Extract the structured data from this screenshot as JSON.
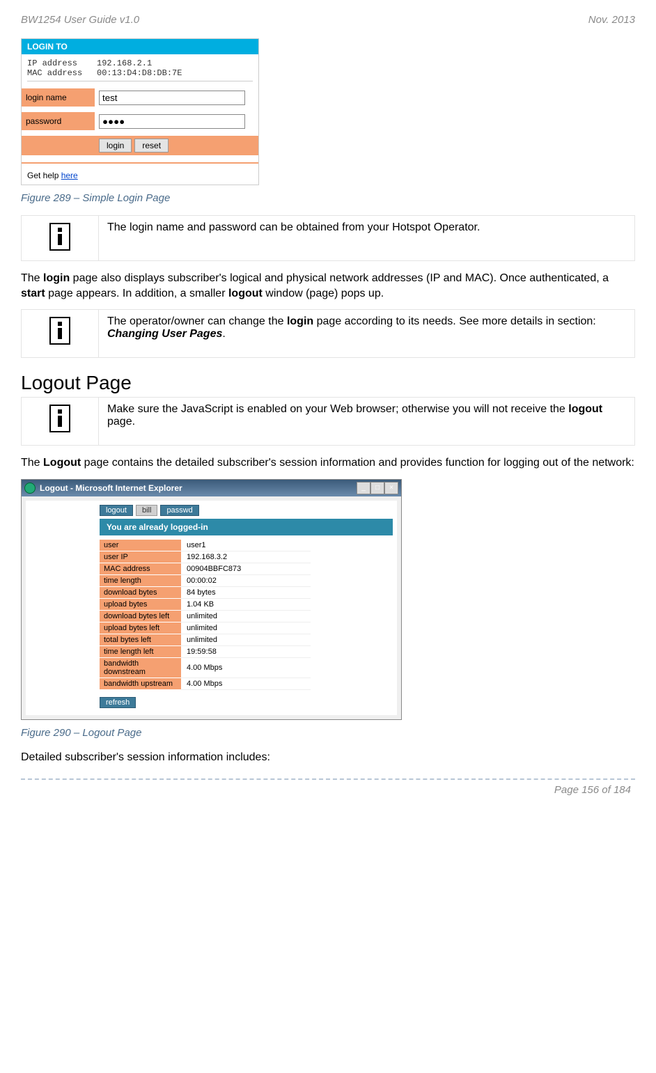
{
  "header": {
    "left": "BW1254 User Guide v1.0",
    "right": "Nov.  2013"
  },
  "login_shot": {
    "title": "LOGIN TO",
    "ip_label": "IP address",
    "ip_value": "192.168.2.1",
    "mac_label": "MAC address",
    "mac_value": "00:13:D4:D8:DB:7E",
    "login_name_label": "login name",
    "login_name_value": "test",
    "password_label": "password",
    "password_value": "●●●●",
    "login_btn": "login",
    "reset_btn": "reset",
    "help_prefix": "Get help ",
    "help_link": "here"
  },
  "fig289": "Figure 289 – Simple Login Page",
  "infobox1": "The login name and password can be obtained from your Hotspot Operator.",
  "para1_a": "The ",
  "para1_b": "login",
  "para1_c": " page also displays subscriber's logical and physical network addresses (IP and MAC). Once authenticated, a ",
  "para1_d": "start",
  "para1_e": " page appears. In addition, a smaller ",
  "para1_f": "logout",
  "para1_g": " window (page) pops up.",
  "infobox2_a": "The operator/owner can change the ",
  "infobox2_b": "login",
  "infobox2_c": " page according to its needs. See more details in section: ",
  "infobox2_d": "Changing User Pages",
  "infobox2_e": ".",
  "section_logout": "Logout Page",
  "infobox3_a": "Make sure the JavaScript is enabled on your Web browser; otherwise you will not receive the ",
  "infobox3_b": "logout",
  "infobox3_c": " page.",
  "para2_a": "The ",
  "para2_b": "Logout",
  "para2_c": " page contains the detailed subscriber's session information and provides function for logging out of the network:",
  "logout_shot": {
    "window_title": "Logout - Microsoft Internet Explorer",
    "tabs": {
      "logout": "logout",
      "bill": "bill",
      "passwd": "passwd"
    },
    "logged_in": "You are already logged-in",
    "rows": [
      {
        "label": "user",
        "value": "user1"
      },
      {
        "label": "user IP",
        "value": "192.168.3.2"
      },
      {
        "label": "MAC address",
        "value": "00904BBFC873"
      },
      {
        "label": "time length",
        "value": "00:00:02"
      },
      {
        "label": "download bytes",
        "value": "84 bytes"
      },
      {
        "label": "upload bytes",
        "value": "1.04 KB"
      },
      {
        "label": "download bytes left",
        "value": "unlimited"
      },
      {
        "label": "upload bytes left",
        "value": "unlimited"
      },
      {
        "label": "total bytes left",
        "value": "unlimited"
      },
      {
        "label": "time length left",
        "value": "19:59:58"
      },
      {
        "label": "bandwidth downstream",
        "value": "4.00 Mbps"
      },
      {
        "label": "bandwidth upstream",
        "value": "4.00 Mbps"
      }
    ],
    "refresh": "refresh"
  },
  "fig290": "Figure 290 – Logout Page",
  "closing": "Detailed subscriber's session information includes:",
  "page_num": "Page 156 of 184"
}
